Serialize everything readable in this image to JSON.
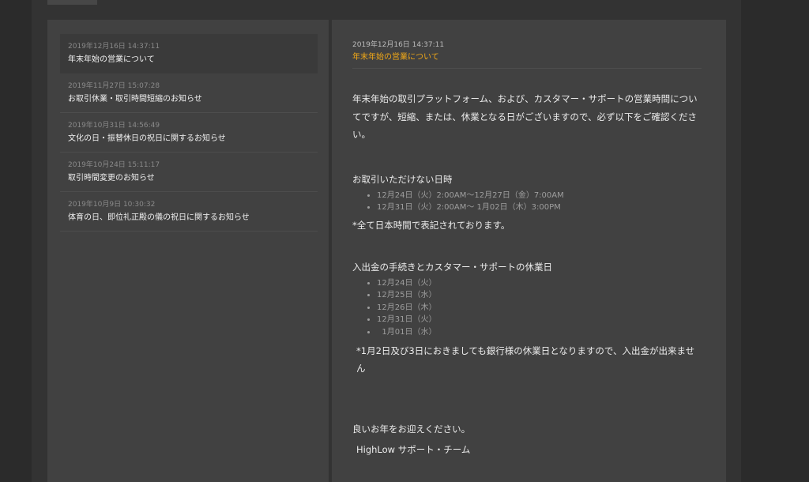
{
  "news_list": [
    {
      "date": "2019年12月16日 14:37:11",
      "title": "年末年始の営業について"
    },
    {
      "date": "2019年11月27日 15:07:28",
      "title": "お取引休業・取引時間短縮のお知らせ"
    },
    {
      "date": "2019年10月31日 14:56:49",
      "title": "文化の日・振替休日の祝日に関するお知らせ"
    },
    {
      "date": "2019年10月24日 15:11:17",
      "title": "取引時間変更のお知らせ"
    },
    {
      "date": "2019年10月9日 10:30:32",
      "title": "体育の日、即位礼正殿の儀の祝日に関するお知らせ"
    }
  ],
  "article": {
    "date": "2019年12月16日 14:37:11",
    "title": "年末年始の営業について",
    "intro": "年末年始の取引プラットフォーム、および、カスタマー・サポートの営業時間についてですが、短縮、または、休業となる日がございますので、必ず以下をご確認ください。",
    "section1_heading": "お取引いただけない日時",
    "section1_items": [
      "12月24日（火）2:00AM～12月27日（金）7:00AM",
      "12月31日（火）2:00AM～ 1月02日（木）3:00PM"
    ],
    "section1_note": "*全て日本時間で表記されております。",
    "section2_heading": "入出金の手続きとカスタマー・サポートの休業日",
    "section2_items": [
      "12月24日（火）",
      "12月25日（水）",
      "12月26日（木）",
      "12月31日（火）",
      "  1月01日（水）"
    ],
    "section2_note": "*1月2日及び3日におきましても銀行様の休業日となりますので、入出金が出来ません",
    "greeting": "良いお年をお迎えください。",
    "signature": "HighLow サポート・チーム"
  },
  "colors": {
    "accent": "#f0a818",
    "panel": "#414141",
    "background": "#2b2b2b"
  }
}
